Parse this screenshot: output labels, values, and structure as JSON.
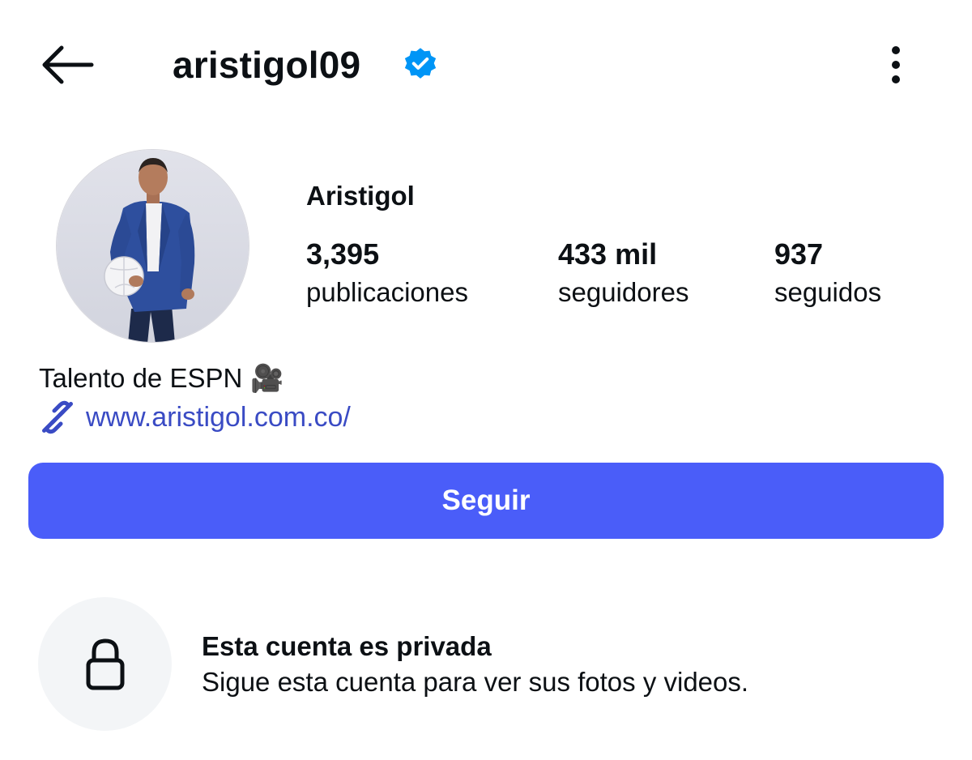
{
  "header": {
    "username": "aristigol09",
    "verified": true,
    "back_icon": "arrow-left-icon",
    "more_icon": "more-vertical-icon"
  },
  "profile": {
    "full_name": "Aristigol",
    "avatar_icon": "profile-photo",
    "stats": [
      {
        "value": "3,395",
        "label": "publicaciones"
      },
      {
        "value": "433 mil",
        "label": "seguidores"
      },
      {
        "value": "937",
        "label": "seguidos"
      }
    ],
    "bio": "Talento de ESPN",
    "bio_emoji": "🎥",
    "link": "www.aristigol.com.co/"
  },
  "actions": {
    "follow_label": "Seguir"
  },
  "private_notice": {
    "title": "Esta cuenta es privada",
    "subtitle": "Sigue esta cuenta para ver sus fotos y videos."
  },
  "colors": {
    "accent": "#4a5df9",
    "verified": "#0095f6",
    "link": "#3a4bc4",
    "lock_bg": "#f3f5f7"
  }
}
